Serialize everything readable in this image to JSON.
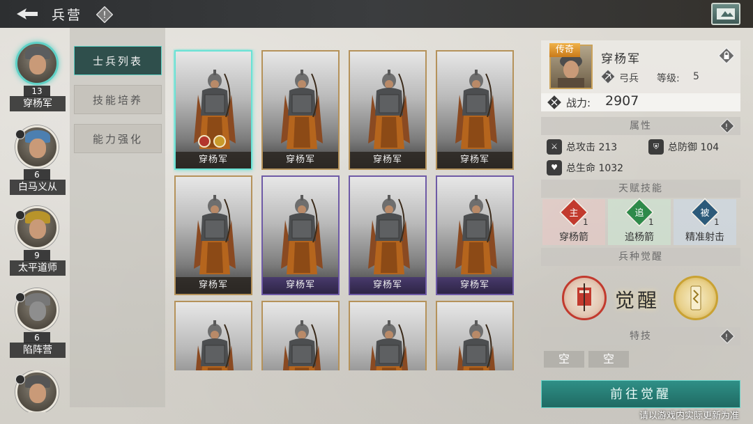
{
  "header": {
    "title": "兵营"
  },
  "roster": [
    {
      "name": "穿杨军",
      "level": "13",
      "active": true
    },
    {
      "name": "白马义从",
      "level": "6",
      "active": false
    },
    {
      "name": "太平道师",
      "level": "9",
      "active": false
    },
    {
      "name": "陷阵营",
      "level": "6",
      "active": false
    },
    {
      "name": "",
      "level": "",
      "active": false
    }
  ],
  "tabs": [
    {
      "label": "士兵列表",
      "active": true
    },
    {
      "label": "技能培养",
      "active": false
    },
    {
      "label": "能力强化",
      "active": false
    }
  ],
  "cards": [
    {
      "label": "穿杨军",
      "frame": "gold",
      "selected": true
    },
    {
      "label": "穿杨军",
      "frame": "gold",
      "selected": false
    },
    {
      "label": "穿杨军",
      "frame": "gold",
      "selected": false
    },
    {
      "label": "穿杨军",
      "frame": "gold",
      "selected": false
    },
    {
      "label": "穿杨军",
      "frame": "gold",
      "selected": false
    },
    {
      "label": "穿杨军",
      "frame": "purple",
      "selected": false
    },
    {
      "label": "穿杨军",
      "frame": "purple",
      "selected": false
    },
    {
      "label": "穿杨军",
      "frame": "purple",
      "selected": false
    },
    {
      "label": "",
      "frame": "gold",
      "selected": false
    },
    {
      "label": "",
      "frame": "gold",
      "selected": false
    },
    {
      "label": "",
      "frame": "gold",
      "selected": false
    },
    {
      "label": "",
      "frame": "gold",
      "selected": false
    }
  ],
  "unit": {
    "rarity": "传奇",
    "name": "穿杨军",
    "type": "弓兵",
    "level_label": "等级:",
    "level": "5",
    "power_label": "战力:",
    "power": "2907"
  },
  "attributes": {
    "title": "属性",
    "attack": "总攻击 213",
    "defense": "总防御 104",
    "life": "总生命 1032"
  },
  "talents": {
    "title": "天赋技能",
    "items": [
      {
        "glyph": "主",
        "count": "1",
        "name": "穿杨箭",
        "color": "#c23a2e"
      },
      {
        "glyph": "追",
        "count": "1",
        "name": "追杨箭",
        "color": "#2e8a4a"
      },
      {
        "glyph": "被",
        "count": "1",
        "name": "精准射击",
        "color": "#2c5a7a"
      }
    ]
  },
  "awaken": {
    "title": "兵种觉醒",
    "text": "觉醒"
  },
  "specialty": {
    "title": "特技",
    "slots": [
      "空",
      "空"
    ]
  },
  "action": {
    "go_awaken": "前往觉醒"
  },
  "footer": {
    "disclaimer": "请以游戏内实际更新为准"
  },
  "colors": {
    "accent": "#5fd1c6",
    "gold_frame": "#b5925a",
    "purple_frame": "#6e5aa6"
  }
}
